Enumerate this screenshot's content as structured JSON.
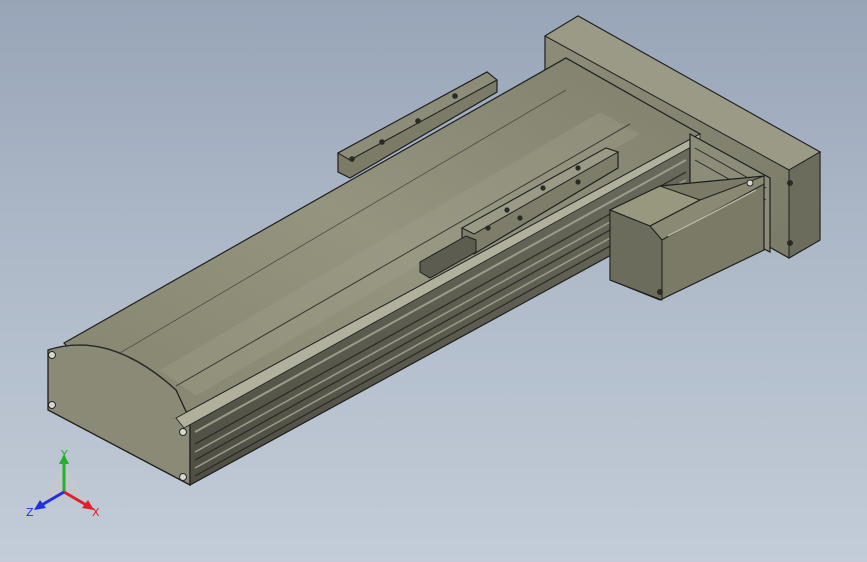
{
  "viewport": {
    "model_name": "linear-actuator-with-stepper-motor"
  },
  "triad": {
    "x_label": "X",
    "y_label": "Y",
    "z_label": "Z"
  },
  "colors": {
    "background_top": "#98a5b8",
    "background_bottom": "#c3ccd8",
    "body_face": "#8a8a76",
    "body_top": "#8f8f7c",
    "body_dark": "#5e5e52",
    "edge": "#1e1e1e",
    "axis_x": "#e0202a",
    "axis_y": "#23b02a",
    "axis_z": "#2030e0"
  }
}
